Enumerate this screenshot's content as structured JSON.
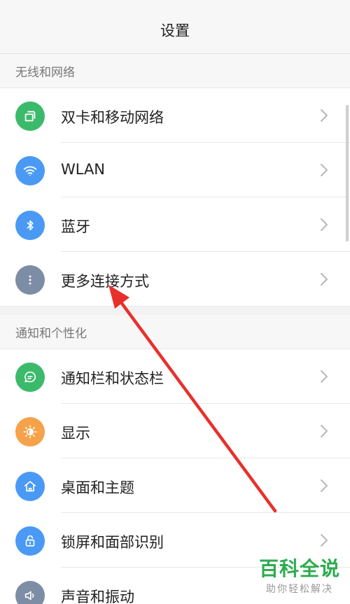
{
  "header": {
    "title": "设置"
  },
  "sections": [
    {
      "title": "无线和网络",
      "items": [
        {
          "label": "双卡和移动网络",
          "icon": "sim-card-icon",
          "color": "#3cba6c"
        },
        {
          "label": "WLAN",
          "icon": "wifi-icon",
          "color": "#4a9af5"
        },
        {
          "label": "蓝牙",
          "icon": "bluetooth-icon",
          "color": "#4a9af5"
        },
        {
          "label": "更多连接方式",
          "icon": "more-dots-icon",
          "color": "#7d8da5"
        }
      ]
    },
    {
      "title": "通知和个性化",
      "items": [
        {
          "label": "通知栏和状态栏",
          "icon": "message-bubble-icon",
          "color": "#3cba6c"
        },
        {
          "label": "显示",
          "icon": "brightness-icon",
          "color": "#f6a24a"
        },
        {
          "label": "桌面和主题",
          "icon": "home-icon",
          "color": "#4a9af5"
        },
        {
          "label": "锁屏和面部识别",
          "icon": "lock-icon",
          "color": "#4a9af5"
        },
        {
          "label": "声音和振动",
          "icon": "speaker-icon",
          "color": "#7d8da5"
        }
      ]
    }
  ],
  "watermark": {
    "main": "百科全说",
    "sub": "助你轻松解决"
  },
  "annotation": {
    "arrow_color": "#e8302b"
  }
}
